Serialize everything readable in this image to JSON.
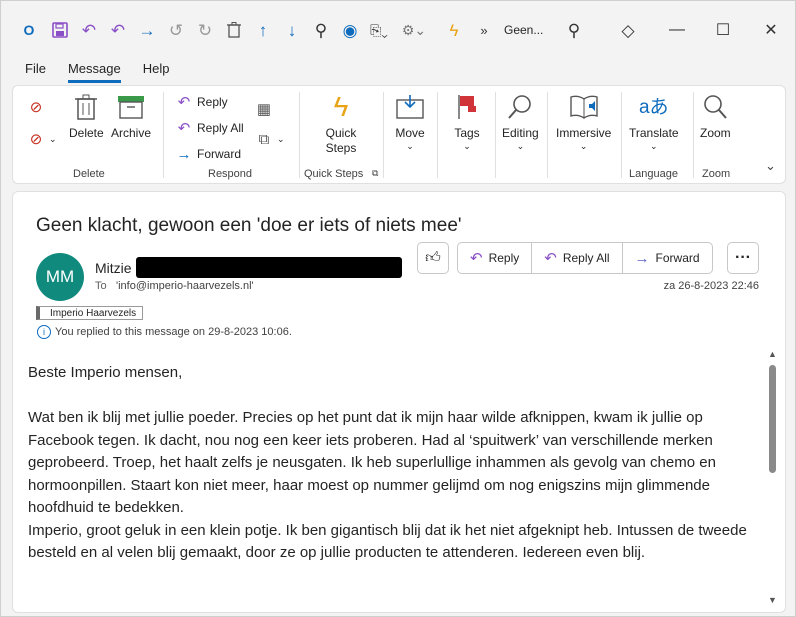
{
  "titlebar": {
    "title": "Geen...",
    "icons": [
      "outlook-logo",
      "save",
      "undo",
      "undo-all",
      "forward-arrow",
      "undo-gray",
      "redo-gray",
      "delete",
      "up-arrow",
      "down-arrow",
      "search",
      "circle",
      "move-to-folder",
      "rules",
      "lightning",
      "overflow"
    ]
  },
  "tabs": [
    "File",
    "Message",
    "Help"
  ],
  "ribbon": {
    "delete_label": "Delete",
    "archive_label": "Archive",
    "group_delete": "Delete",
    "reply_label": "Reply",
    "reply_all_label": "Reply All",
    "forward_label": "Forward",
    "group_respond": "Respond",
    "quick_steps_label": "Quick Steps",
    "group_quick_steps": "Quick Steps",
    "move_label": "Move",
    "tags_label": "Tags",
    "editing_label": "Editing",
    "immersive_label": "Immersive",
    "translate_label": "Translate",
    "group_language": "Language",
    "zoom_label": "Zoom",
    "group_zoom": "Zoom"
  },
  "message": {
    "subject": "Geen klacht, gewoon een 'doe er iets of niets mee'",
    "avatar_initials": "MM",
    "sender_name": "Mitzie",
    "to_label": "To",
    "to_value": "'info@imperio-haarvezels.nl'",
    "date": "za 26-8-2023 22:46",
    "reply_button": "Reply",
    "reply_all_button": "Reply All",
    "forward_button": "Forward",
    "category_tag": "Imperio Haarvezels",
    "info_text": "You replied to this message on 29-8-2023 10:06.",
    "body": [
      "Beste Imperio mensen,",
      "Wat ben ik blij met jullie poeder. Precies op het punt dat ik mijn haar wilde afknippen, kwam ik jullie op Facebook tegen. Ik dacht, nou nog een keer iets proberen. Had al ‘spuitwerk’ van verschillende merken geprobeerd. Troep, het haalt zelfs je neusgaten. Ik heb superlullige inhammen als gevolg van chemo en hormoonpillen. Staart kon niet meer, haar moest op nummer gelijmd om nog enigszins mijn glimmende hoofdhuid te bedekken.",
      "Imperio, groot geluk in een klein potje. Ik ben gigantisch blij dat ik het niet afgeknipt heb. Intussen de tweede besteld en al velen blij gemaakt, door ze op jullie producten te attenderen. Iedereen even blij."
    ]
  },
  "colors": {
    "accent": "#0f6cbd",
    "avatar": "#118a7e",
    "outlook": "#5b5fc7"
  }
}
